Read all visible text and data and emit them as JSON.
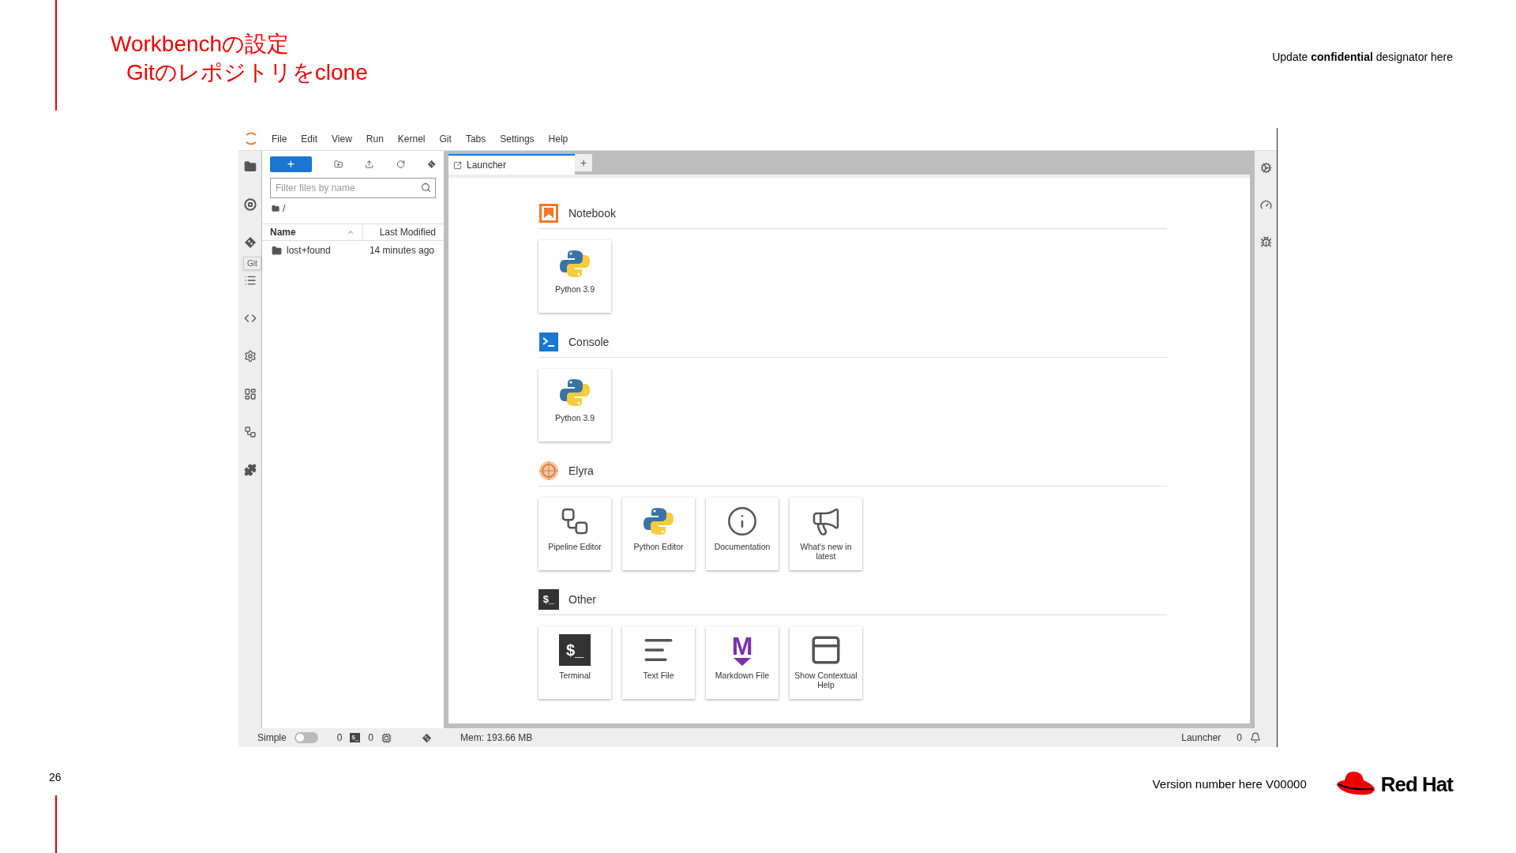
{
  "slide": {
    "title_lines": [
      "Workbenchの設定",
      "Gitのレポジトリをclone"
    ],
    "confidential": "Update **confidential** designator here",
    "page_number": "26",
    "version": "Version number here V00000",
    "brand": "Red Hat"
  },
  "app": {
    "menu": [
      "File",
      "Edit",
      "View",
      "Run",
      "Kernel",
      "Git",
      "Tabs",
      "Settings",
      "Help"
    ],
    "tooltip": "Git",
    "file_browser": {
      "new_button": "+",
      "filter": {
        "placeholder": "Filter files by name"
      },
      "path": "/",
      "columns": [
        {
          "label": "Name",
          "sorted": true
        },
        {
          "label": "Last Modified",
          "sorted": false
        }
      ],
      "rows": [
        {
          "name": "lost+found",
          "modified": "14 minutes ago"
        }
      ]
    },
    "tabs": [
      {
        "label": "Launcher",
        "selected": true
      }
    ],
    "add_tab": "+",
    "sections": [
      {
        "title": "Notebook",
        "kind": "notebook",
        "items": [
          {
            "label": "Python 3.9",
            "kind": "python"
          }
        ]
      },
      {
        "title": "Console",
        "kind": "console",
        "items": [
          {
            "label": "Python 3.9",
            "kind": "python"
          }
        ]
      },
      {
        "title": "Elyra",
        "kind": "elyra",
        "items": [
          {
            "label": "Pipeline Editor",
            "kind": "pipeline"
          },
          {
            "label": "Python Editor",
            "kind": "python"
          },
          {
            "label": "Documentation",
            "kind": "docs"
          },
          {
            "label": "What's new in latest",
            "kind": "whatsnew"
          }
        ]
      },
      {
        "title": "Other",
        "kind": "other",
        "glyph": "$_",
        "items": [
          {
            "label": "Terminal",
            "kind": "terminal",
            "glyph": "$_"
          },
          {
            "label": "Text File",
            "kind": "textfile"
          },
          {
            "label": "Markdown File",
            "kind": "markdown",
            "glyph": "M"
          },
          {
            "label": "Show Contextual Help",
            "kind": "help"
          }
        ]
      }
    ],
    "status_bar": {
      "mode_label": "Simple",
      "simple_mode": false,
      "kernels": "0",
      "terminal_glyph": "$_",
      "terminals": "0",
      "memory": "Mem: 193.66 MB",
      "activity": "Launcher",
      "notifications": "0"
    }
  }
}
